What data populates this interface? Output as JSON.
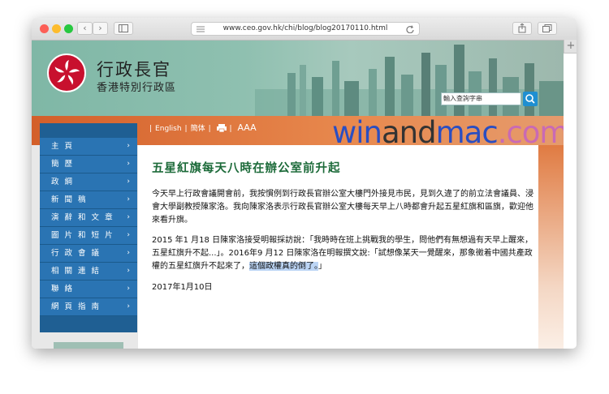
{
  "browser": {
    "url": "www.ceo.gov.hk/chi/blog/blog20170110.html",
    "plus_label": "+"
  },
  "site": {
    "title": "行政長官",
    "subtitle": "香港特別行政區",
    "search_placeholder": "輸入查詢字串",
    "lang_links": [
      "English",
      "簡体"
    ],
    "font_size_label": "AAA"
  },
  "watermark": {
    "part1": "win",
    "part2": "and",
    "part3": "mac",
    "part4": ".com"
  },
  "sidebar": {
    "items": [
      {
        "label": "主 頁"
      },
      {
        "label": "簡 歷"
      },
      {
        "label": "政 綱"
      },
      {
        "label": "新 聞 稿"
      },
      {
        "label": "演 辭 和 文 章"
      },
      {
        "label": "圖 片 和 短 片"
      },
      {
        "label": "行 政 會 議"
      },
      {
        "label": "相 關 連 結"
      },
      {
        "label": "聯 絡"
      },
      {
        "label": "網 頁 指 南"
      }
    ]
  },
  "article": {
    "title": "五星紅旗每天八時在辦公室前升起",
    "paragraph1": "今天早上行政會議開會前，我按慣例到行政長官辦公室大樓門外接見市民，見到久違了的前立法會議員、浸會大學副教授陳家洛。我向陳家洛表示行政長官辦公室大樓每天早上八時都會升起五星紅旗和區旗，歡迎他來看升旗。",
    "paragraph2_main": "2015 年1 月18 日陳家洛接受明報採訪說：「我時時在班上挑戰我的學生，問他們有無想過有天早上醒來，五星紅旗升不起...」。2016年9 月12 日陳家洛在明報撰文說:「試想像某天一覺醒來，那象徵着中國共產政權的五星紅旗升不起來了，",
    "paragraph2_highlight": "這個政權真的倒了。",
    "paragraph2_end": "」",
    "date": "2017年1月10日"
  }
}
